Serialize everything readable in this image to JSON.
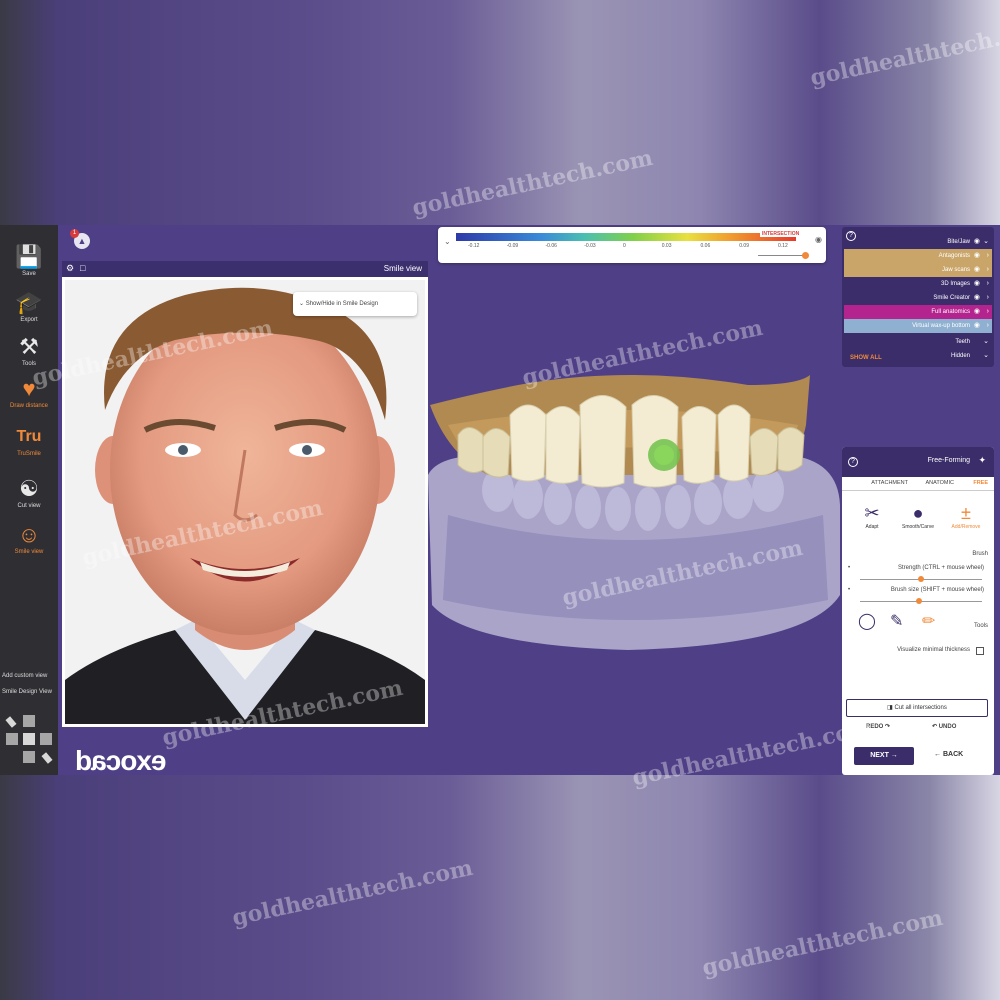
{
  "watermark": "goldhealthtech.com",
  "toolbar": {
    "save": "Save",
    "export": "Export",
    "tools": "Tools",
    "draw_distance": "Draw distance",
    "trusmile": "TruSmile",
    "cut_view": "Cut view",
    "smile_view": "Smile view",
    "add_custom_view": "Add custom view",
    "smile_design_view": "Smile Design View",
    "tru_logo": "Tru"
  },
  "notification": {
    "count": "1"
  },
  "smile_panel": {
    "title": "Smile view",
    "dropdown": "Show/Hide in Smile Design"
  },
  "brand": "exocad",
  "scale": {
    "tag": "INTERSECTION",
    "ticks": [
      "-0.12",
      "-0.09",
      "-0.06",
      "-0.03",
      "0",
      "0.03",
      "0.06",
      "0.09",
      "0.12"
    ]
  },
  "objects": {
    "items": [
      "Bite/Jaw",
      "Antagonists",
      "Jaw scans",
      "3D Images",
      "Smile Creator",
      "Full anatomics",
      "Virtual wax-up bottom",
      "Teeth",
      "Hidden"
    ],
    "show_all": "SHOW ALL",
    "colors": {
      "highlight_tan": "#c9a56a",
      "highlight_magenta": "#b4248e",
      "highlight_blue": "#8fb0d0"
    }
  },
  "free_forming": {
    "title": "Free-Forming",
    "tabs": [
      "FREE",
      "ANATOMIC",
      "ATTACHMENT"
    ],
    "tools": [
      "Add/Remove",
      "Smooth/Carve",
      "Adapt"
    ],
    "brush_label": "Brush",
    "strength": "Strength (CTRL + mouse wheel)",
    "brush_size": "Brush size (SHIFT + mouse wheel)",
    "tools_label": "Tools",
    "visualize": "Visualize minimal thickness",
    "cut_intersections": "Cut all intersections",
    "undo": "UNDO",
    "redo": "REDO",
    "back": "BACK",
    "next": "NEXT",
    "strength_level": 0.5,
    "brush_size_level": 0.48
  },
  "accent": "#f08a3a",
  "panel_color": "#3a2d6a"
}
